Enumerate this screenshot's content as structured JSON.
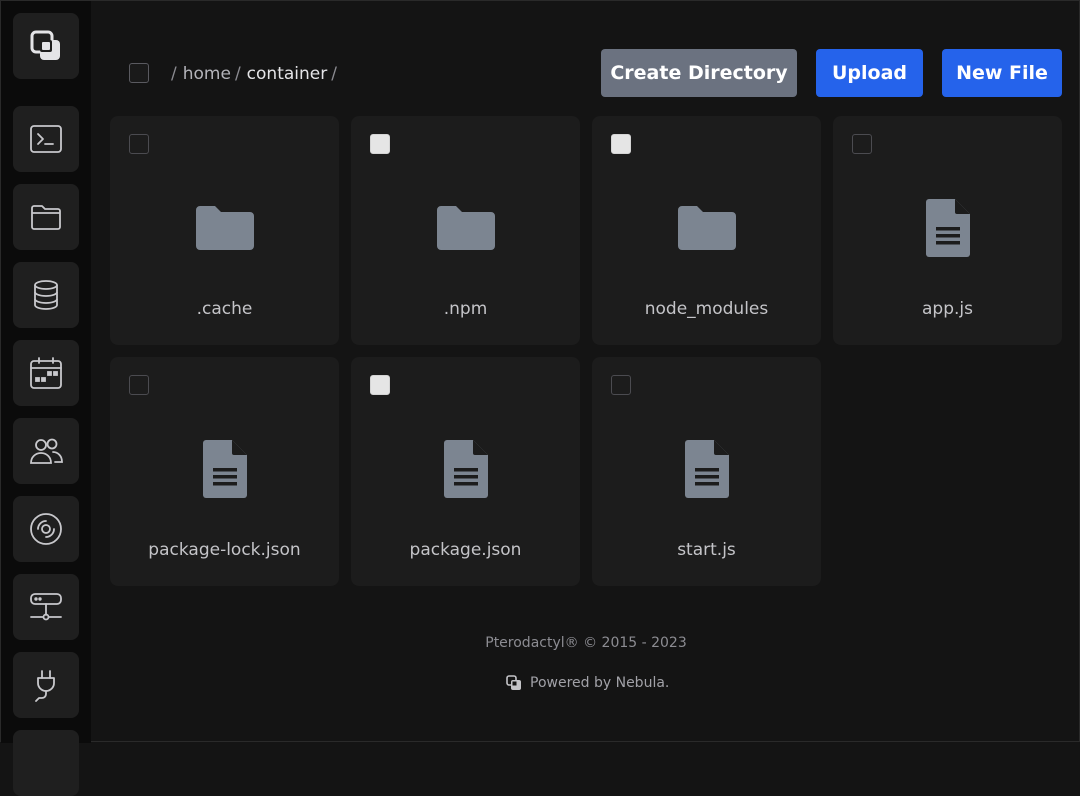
{
  "sidebar": {
    "items": [
      {
        "icon": "nebula-logo-icon"
      },
      {
        "icon": "terminal-icon"
      },
      {
        "icon": "folder-icon"
      },
      {
        "icon": "database-icon"
      },
      {
        "icon": "calendar-icon"
      },
      {
        "icon": "users-icon"
      },
      {
        "icon": "backup-disc-icon"
      },
      {
        "icon": "network-icon"
      },
      {
        "icon": "plug-icon"
      }
    ]
  },
  "breadcrumb": {
    "sep1": "/",
    "home": "home",
    "sep2": "/",
    "container": "container",
    "sep3": "/"
  },
  "toolbar": {
    "create_directory": "Create Directory",
    "upload": "Upload",
    "new_file": "New File"
  },
  "files": [
    {
      "name": ".cache",
      "type": "folder",
      "selected": false
    },
    {
      "name": ".npm",
      "type": "folder",
      "selected": true
    },
    {
      "name": "node_modules",
      "type": "folder",
      "selected": true
    },
    {
      "name": "app.js",
      "type": "file",
      "selected": false
    },
    {
      "name": "package-lock.json",
      "type": "file",
      "selected": false
    },
    {
      "name": "package.json",
      "type": "file",
      "selected": true
    },
    {
      "name": "start.js",
      "type": "file",
      "selected": false
    }
  ],
  "footer": {
    "copyright": "Pterodactyl® © 2015 - 2023",
    "powered_by": "Powered by Nebula."
  },
  "colors": {
    "accent_blue": "#2563eb",
    "button_gray": "#6b7280",
    "card_bg": "#1c1c1c",
    "icon_gray": "#7c8591"
  }
}
